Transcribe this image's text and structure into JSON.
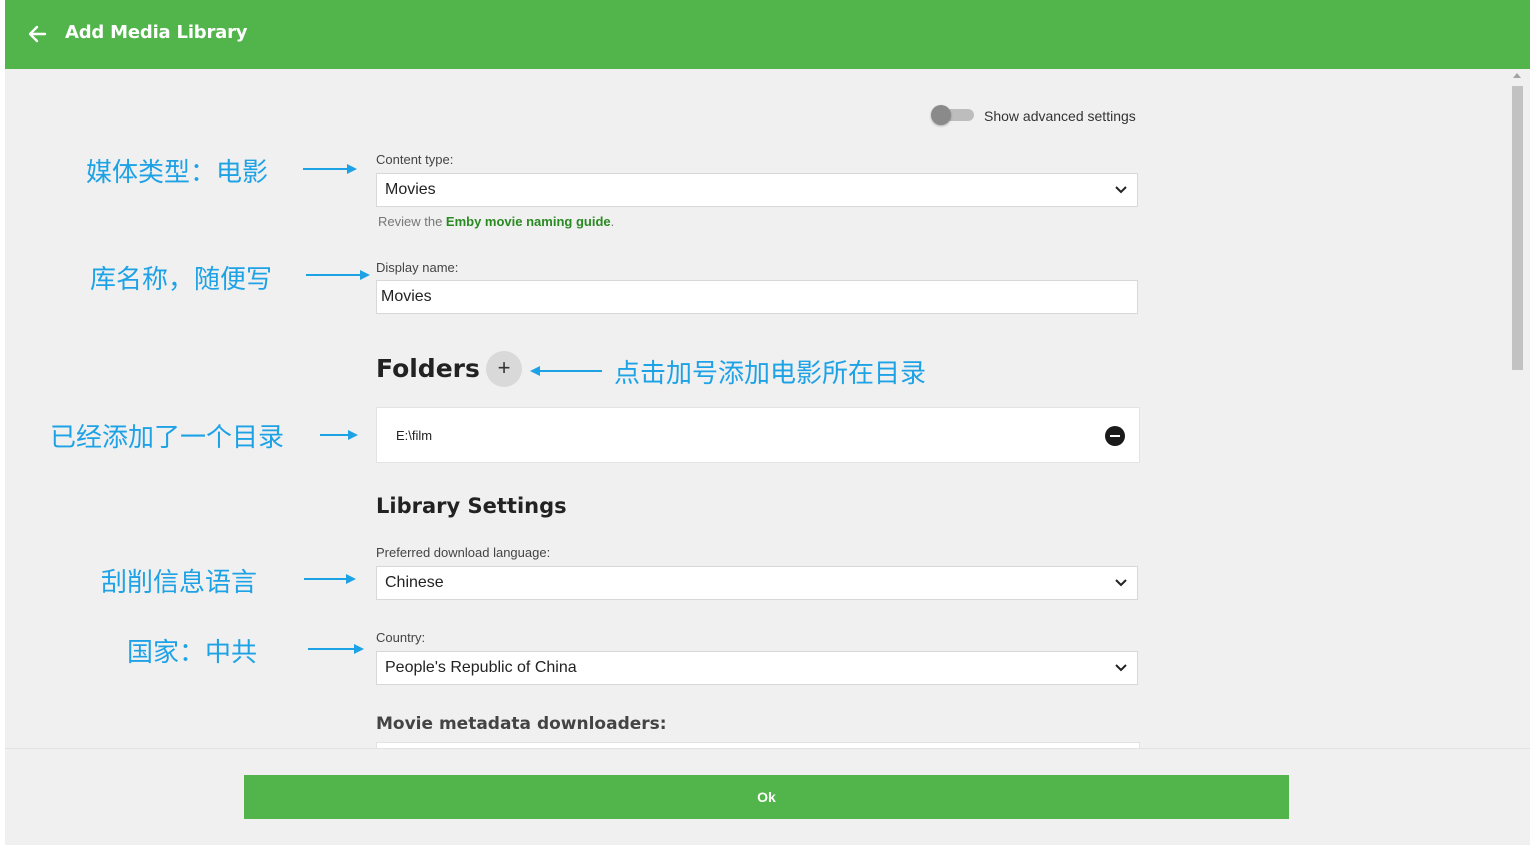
{
  "header": {
    "title": "Add Media Library"
  },
  "advanced_toggle": {
    "label": "Show advanced settings"
  },
  "content_type": {
    "label": "Content type:",
    "value": "Movies",
    "hint_prefix": "Review the ",
    "hint_link": "Emby movie naming guide",
    "hint_suffix": "."
  },
  "display_name": {
    "label": "Display name:",
    "value": "Movies"
  },
  "folders": {
    "title": "Folders",
    "add_label": "+",
    "items": [
      {
        "path": "E:\\film"
      }
    ]
  },
  "library_settings": {
    "title": "Library Settings",
    "language": {
      "label": "Preferred download language:",
      "value": "Chinese"
    },
    "country": {
      "label": "Country:",
      "value": "People's Republic of China"
    },
    "metadata_title": "Movie metadata downloaders:"
  },
  "annotations": {
    "content_type": "媒体类型：电影",
    "display_name": "库名称，随便写",
    "add_folder": "点击加号添加电影所在目录",
    "folder_added": "已经添加了一个目录",
    "language": "刮削信息语言",
    "country": "国家：中共"
  },
  "annotation_color": "#1ea2e6",
  "accent_color": "#52b54b",
  "footer": {
    "ok_label": "Ok"
  }
}
